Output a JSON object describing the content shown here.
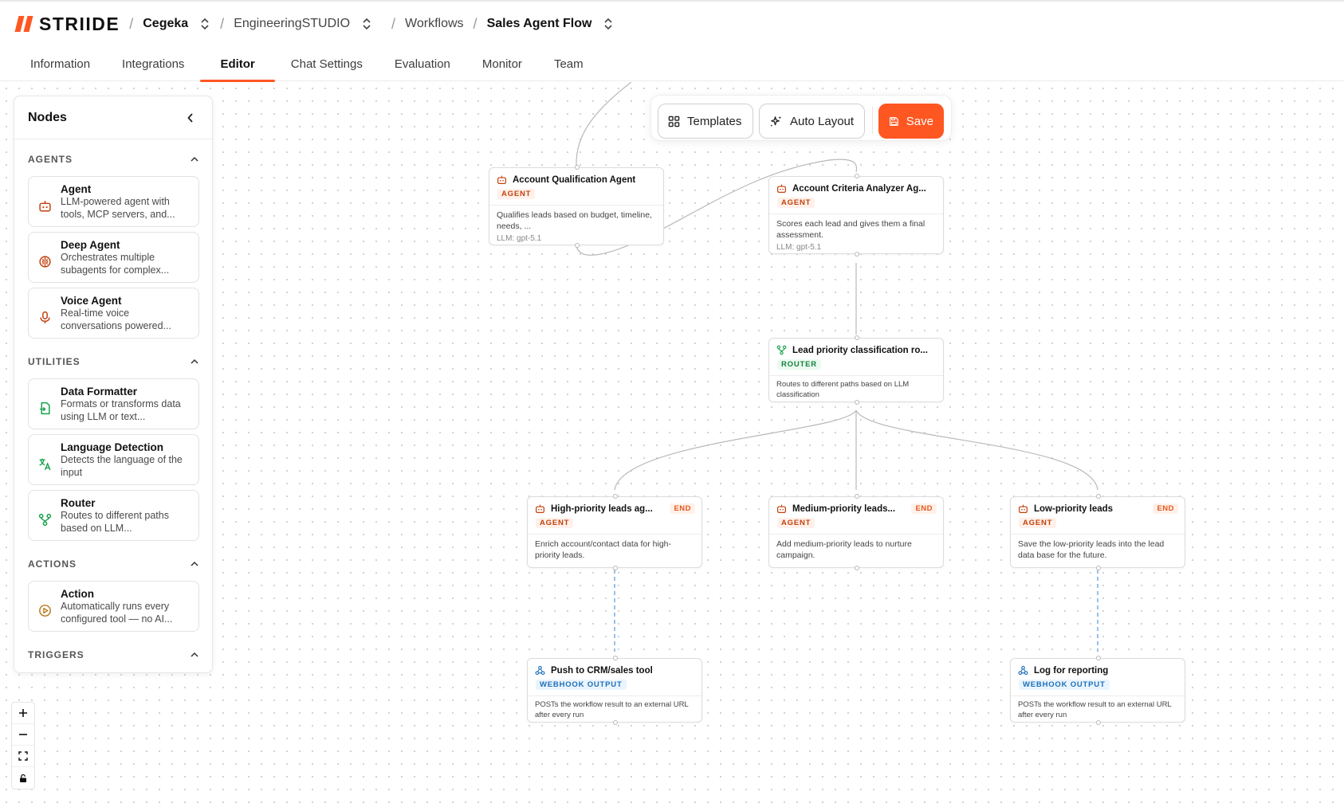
{
  "header": {
    "brand": "STRIIDE",
    "breadcrumbs": [
      "Cegeka",
      "EngineeringSTUDIO",
      "Workflows",
      "Sales Agent Flow"
    ]
  },
  "tabs": [
    "Information",
    "Integrations",
    "Editor",
    "Chat Settings",
    "Evaluation",
    "Monitor",
    "Team"
  ],
  "active_tab": "Editor",
  "sidebar": {
    "title": "Nodes",
    "sections": {
      "agents": {
        "label": "AGENTS",
        "items": [
          {
            "title": "Agent",
            "desc": "LLM-powered agent with tools, MCP servers, and..."
          },
          {
            "title": "Deep Agent",
            "desc": "Orchestrates multiple subagents for complex..."
          },
          {
            "title": "Voice Agent",
            "desc": "Real-time voice conversations powered..."
          }
        ]
      },
      "utilities": {
        "label": "UTILITIES",
        "items": [
          {
            "title": "Data Formatter",
            "desc": "Formats or transforms data using LLM or text..."
          },
          {
            "title": "Language Detection",
            "desc": "Detects the language of the input"
          },
          {
            "title": "Router",
            "desc": "Routes to different paths based on LLM..."
          }
        ]
      },
      "actions": {
        "label": "ACTIONS",
        "items": [
          {
            "title": "Action",
            "desc": "Automatically runs every configured tool — no AI..."
          }
        ]
      },
      "triggers": {
        "label": "TRIGGERS"
      }
    }
  },
  "toolbar": {
    "templates_label": "Templates",
    "auto_layout_label": "Auto Layout",
    "save_label": "Save"
  },
  "nodes": {
    "account_qualification": {
      "title": "Account Qualification Agent",
      "badge": "AGENT",
      "desc": "Qualifies leads based on budget, timeline, needs, ...",
      "llm": "LLM: gpt-5.1"
    },
    "account_criteria": {
      "title": "Account Criteria Analyzer Ag...",
      "badge": "AGENT",
      "desc": "Scores each lead and gives them a final assessment.",
      "llm": "LLM: gpt-5.1"
    },
    "lead_priority": {
      "title": "Lead priority classification ro...",
      "badge": "ROUTER",
      "desc": "Routes to different paths based on LLM classification"
    },
    "high_priority": {
      "title": "High-priority leads ag...",
      "badge": "AGENT",
      "end": "END",
      "desc": "Enrich account/contact data for high-priority leads."
    },
    "medium_priority": {
      "title": "Medium-priority leads...",
      "badge": "AGENT",
      "end": "END",
      "desc": "Add medium-priority leads to nurture campaign."
    },
    "low_priority": {
      "title": "Low-priority leads",
      "badge": "AGENT",
      "end": "END",
      "desc": "Save the low-priority leads into the lead data base for the future."
    },
    "push_crm": {
      "title": "Push to CRM/sales tool",
      "badge": "WEBHOOK OUTPUT",
      "desc": "POSTs the workflow result to an external URL after every run"
    },
    "log_reporting": {
      "title": "Log for reporting",
      "badge": "WEBHOOK OUTPUT",
      "desc": "POSTs the workflow result to an external URL after every run"
    }
  },
  "colors": {
    "accent": "#ff5722",
    "agent_icon": "#c2410c",
    "router_icon": "#16a34a",
    "webhook_icon": "#1d6fb8",
    "action_icon": "#b7791f"
  }
}
